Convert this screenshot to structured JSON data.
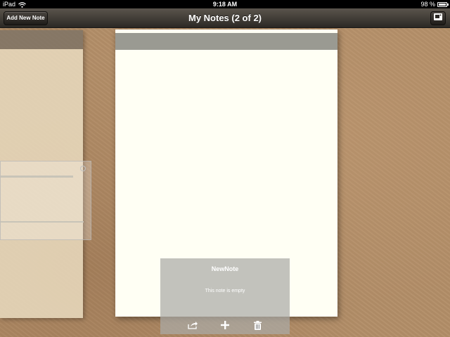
{
  "status_bar": {
    "device": "iPad",
    "time": "9:18 AM",
    "battery": "98 %",
    "battery_level": 0.98,
    "icons": [
      "wifi-icon",
      "battery-icon"
    ]
  },
  "nav_bar": {
    "add_button_label": "Add New Note",
    "title": "My Notes (2 of 2)",
    "right_icon": "photo-camera-icon"
  },
  "note_card": {
    "title": "NewNote",
    "body": "This note is empty",
    "toolbar_icons": [
      "share-icon",
      "add-icon",
      "trash-icon"
    ]
  },
  "colors": {
    "nav_bar": "#3d3934",
    "note_paper": "#fffff4",
    "note_header": "#9a9a92",
    "desk": "#b38e68"
  }
}
